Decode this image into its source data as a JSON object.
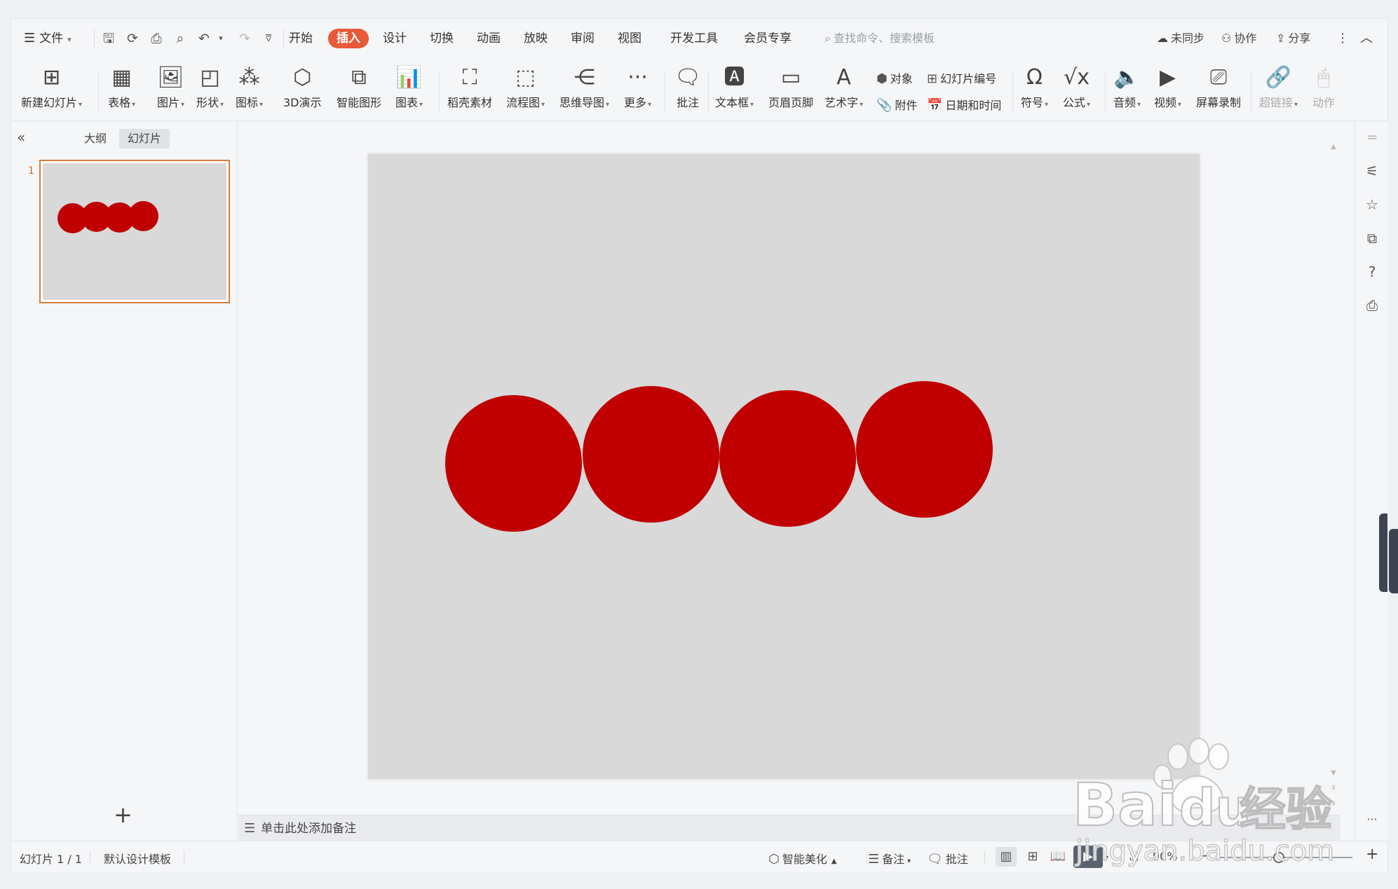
{
  "menu": {
    "file": "文件",
    "tabs": [
      "开始",
      "插入",
      "设计",
      "切换",
      "动画",
      "放映",
      "审阅",
      "视图",
      "开发工具",
      "会员专享"
    ],
    "active_tab": "插入",
    "search_placeholder": "查找命令、搜索模板",
    "right": {
      "sync": "未同步",
      "collab": "协作",
      "share": "分享"
    }
  },
  "ribbon": {
    "new_slide": "新建幻灯片",
    "table": "表格",
    "picture": "图片",
    "shape": "形状",
    "icon": "图标",
    "demo3d": "3D演示",
    "smartart": "智能图形",
    "chart": "图表",
    "docer": "稻壳素材",
    "flow": "流程图",
    "mindmap": "思维导图",
    "more": "更多",
    "comment": "批注",
    "textbox": "文本框",
    "header_footer": "页眉页脚",
    "wordart": "艺术字",
    "object": "对象",
    "attachment": "附件",
    "slide_number": "幻灯片编号",
    "datetime": "日期和时间",
    "symbol": "符号",
    "formula": "公式",
    "audio": "音频",
    "video": "视频",
    "screen_record": "屏幕录制",
    "hyperlink": "超链接",
    "action": "动作"
  },
  "panel": {
    "tab_outline": "大纲",
    "tab_slides": "幻灯片",
    "slide_number": "1"
  },
  "slide": {
    "background": "#d9d9d9",
    "circle_color": "#c00000"
  },
  "notes_placeholder": "单击此处添加备注",
  "status": {
    "slide_info": "幻灯片 1 / 1",
    "template": "默认设计模板",
    "beautify": "智能美化",
    "notes": "备注",
    "comment": "批注",
    "zoom": "90%"
  },
  "watermark": {
    "brand": "Bai",
    "brand2": "du",
    "cn": "经验",
    "url": "jingyan.baidu.com"
  }
}
